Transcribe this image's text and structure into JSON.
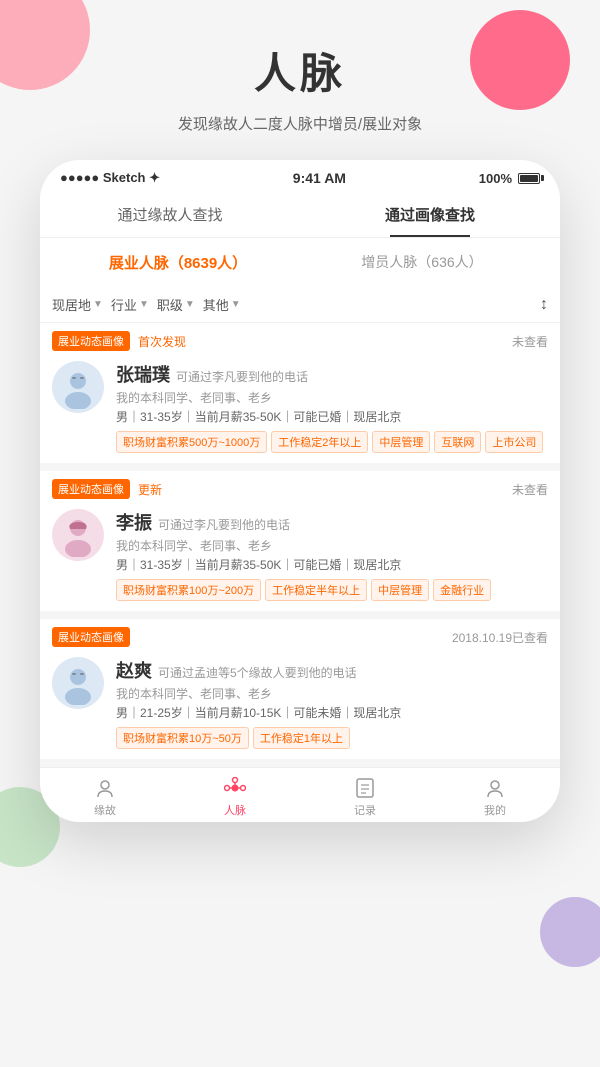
{
  "app": {
    "title": "人脉",
    "subtitle": "发现缘故人二度人脉中增员/展业对象"
  },
  "statusBar": {
    "left": "●●●●● Sketch ✦",
    "center": "9:41 AM",
    "right": "100%"
  },
  "tabs": {
    "items": [
      {
        "label": "通过缘故人查找",
        "active": false
      },
      {
        "label": "通过画像查找",
        "active": true
      }
    ]
  },
  "subTabs": {
    "items": [
      {
        "label": "展业人脉（8639人）",
        "active": true
      },
      {
        "label": "增员人脉（636人）",
        "active": false
      }
    ]
  },
  "filters": {
    "items": [
      {
        "label": "现居地",
        "arrow": "▼"
      },
      {
        "label": "行业",
        "arrow": "▼"
      },
      {
        "label": "职级",
        "arrow": "▼"
      },
      {
        "label": "其他",
        "arrow": "▼"
      }
    ],
    "sort_icon": "↕"
  },
  "cards": [
    {
      "badge": "展业动态画像",
      "badge_label": "首次发现",
      "time": "未查看",
      "name": "张瑞璞",
      "connection": "可通过李凡要到他的电话",
      "desc": "我的本科同学、老同事、老乡",
      "detail": "男｜31-35岁｜当前月薪35-50K｜可能已婚｜现居北京",
      "tags": [
        "职场财富积累500万~1000万",
        "工作稳定2年以上",
        "中层管理",
        "互联网",
        "上市公司"
      ],
      "gender": "male"
    },
    {
      "badge": "展业动态画像",
      "badge_label": "更新",
      "time": "未查看",
      "name": "李振",
      "connection": "可通过李凡要到他的电话",
      "desc": "我的本科同学、老同事、老乡",
      "detail": "男｜31-35岁｜当前月薪35-50K｜可能已婚｜现居北京",
      "tags": [
        "职场财富积累100万~200万",
        "工作稳定半年以上",
        "中层管理",
        "金融行业"
      ],
      "gender": "female"
    },
    {
      "badge": "展业动态画像",
      "badge_label": "",
      "time": "2018.10.19已查看",
      "name": "赵爽",
      "connection": "可通过孟迪等5个缘故人要到他的电话",
      "desc": "我的本科同学、老同事、老乡",
      "detail": "男｜21-25岁｜当前月薪10-15K｜可能未婚｜现居北京",
      "tags": [
        "职场财富积累10万~50万",
        "工作稳定1年以上"
      ],
      "gender": "male"
    }
  ],
  "bottomNav": {
    "items": [
      {
        "label": "缘故",
        "active": false,
        "icon": "person"
      },
      {
        "label": "人脉",
        "active": true,
        "icon": "network"
      },
      {
        "label": "记录",
        "active": false,
        "icon": "calendar"
      },
      {
        "label": "我的",
        "active": false,
        "icon": "me"
      }
    ]
  }
}
